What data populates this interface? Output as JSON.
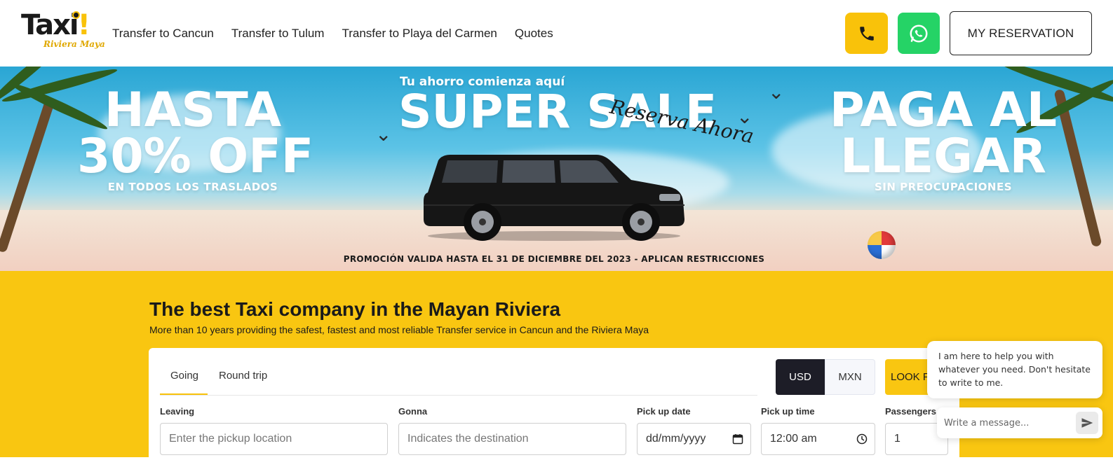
{
  "brand": {
    "logo_text": "Taxi",
    "logo_mark": "!",
    "logo_sub": "Riviera Maya",
    "accent": "#f9c611",
    "whatsapp": "#25d366"
  },
  "nav": {
    "items": [
      "Transfer to Cancun",
      "Transfer to Tulum",
      "Transfer to Playa del Carmen",
      "Quotes"
    ],
    "phone_icon": "phone-icon",
    "whatsapp_icon": "whatsapp-icon",
    "reservation_label": "MY RESERVATION"
  },
  "banner": {
    "left_title_1": "HASTA",
    "left_title_2": "30% OFF",
    "left_sub": "EN TODOS LOS TRASLADOS",
    "center_tagline": "Tu ahorro comienza aquí",
    "center_title": "SUPER SALE",
    "center_script": "Reserva Ahora",
    "right_title_1": "PAGA AL",
    "right_title_2": "LLEGAR",
    "right_sub": "SIN PREOCUPACIONES",
    "promo": "PROMOCIÓN VALIDA HASTA EL 31 DE DICIEMBRE DEL 2023 - APLICAN RESTRICCIONES"
  },
  "hero": {
    "title": "The best Taxi company in the Mayan Riviera",
    "subtitle": "More than 10 years providing the safest, fastest and most reliable Transfer service in Cancun and the Riviera Maya"
  },
  "booking": {
    "tabs": [
      "Going",
      "Round trip"
    ],
    "active_tab": "Going",
    "currency": {
      "usd": "USD",
      "mxn": "MXN",
      "selected": "USD"
    },
    "look_button": "LOOK F",
    "fields": {
      "leaving": {
        "label": "Leaving",
        "placeholder": "Enter the pickup location"
      },
      "gonna": {
        "label": "Gonna",
        "placeholder": "Indicates the destination"
      },
      "date": {
        "label": "Pick up date",
        "value": "dd/mm/yyyy"
      },
      "time": {
        "label": "Pick up time",
        "value": "12:00 am"
      },
      "passengers": {
        "label": "Passengers",
        "value": "1"
      }
    }
  },
  "chat": {
    "message": "I am here to help you with whatever you need. Don't hesitate to write to me.",
    "placeholder": "Write a message..."
  }
}
